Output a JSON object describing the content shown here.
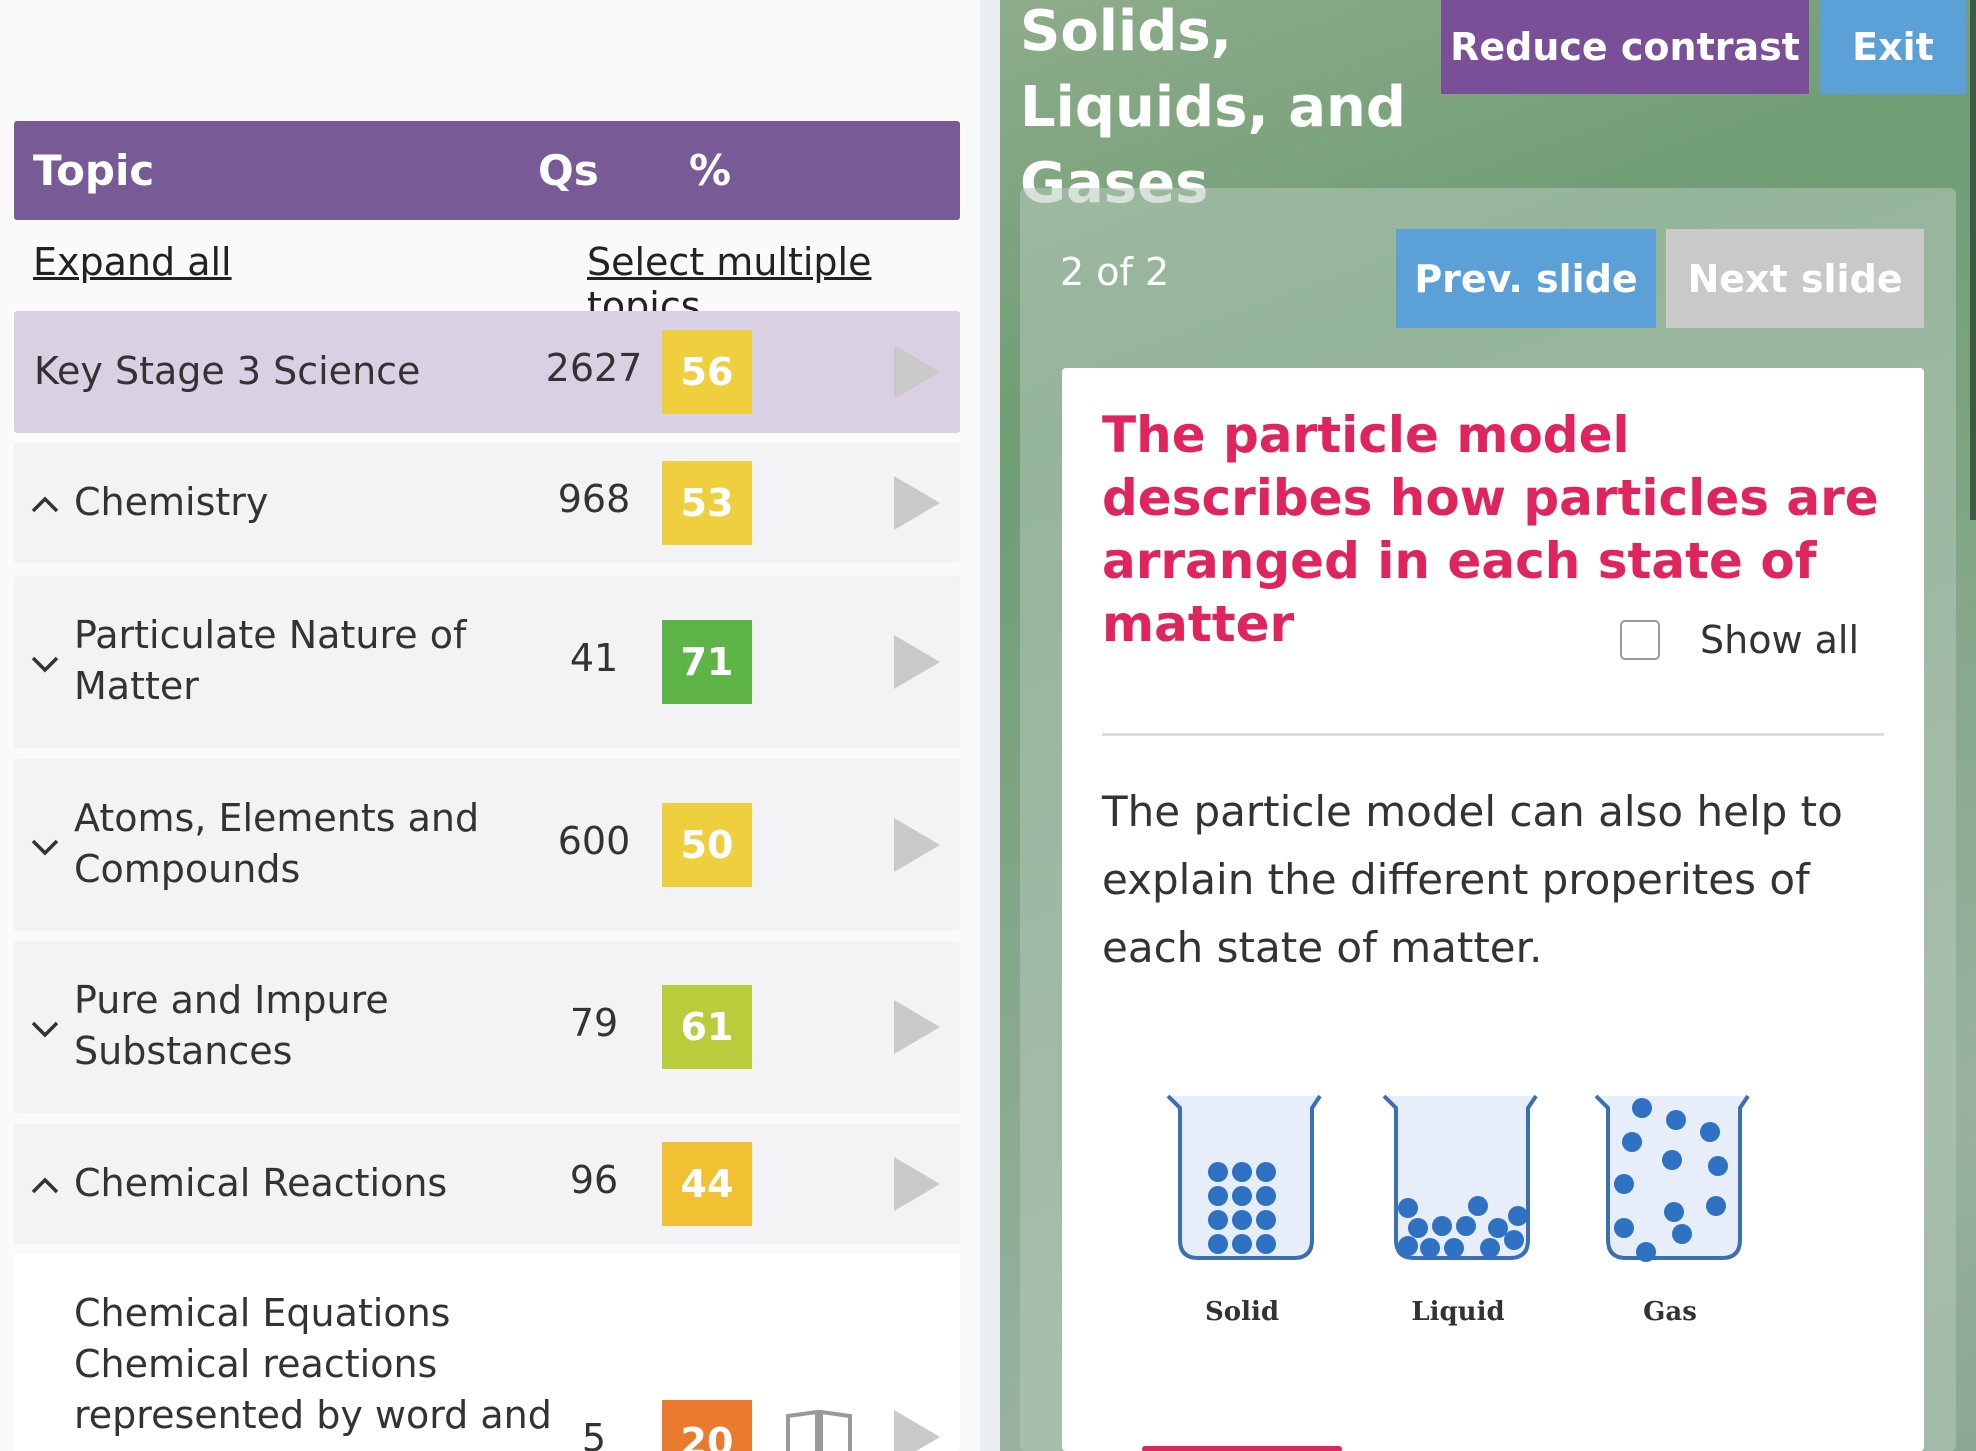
{
  "topic_table": {
    "header": {
      "topic": "Topic",
      "qs": "Qs",
      "pct": "%"
    },
    "expand_all": "Expand all",
    "select_multiple": "Select multiple topics",
    "rows": [
      {
        "name": "Key Stage 3 Science",
        "qs": "2627",
        "pct": "56",
        "pct_color": "#f0cf3e",
        "chevron": "none"
      },
      {
        "name": "Chemistry",
        "qs": "968",
        "pct": "53",
        "pct_color": "#f0cf3e",
        "chevron": "up"
      },
      {
        "name_line1": "Particulate Nature of",
        "name_line2": "Matter",
        "qs": "41",
        "pct": "71",
        "pct_color": "#5fb447",
        "chevron": "down"
      },
      {
        "name_line1": "Atoms, Elements and",
        "name_line2": "Compounds",
        "qs": "600",
        "pct": "50",
        "pct_color": "#f0cf3e",
        "chevron": "down"
      },
      {
        "name_line1": "Pure and Impure",
        "name_line2": "Substances",
        "qs": "79",
        "pct": "61",
        "pct_color": "#b8cc3c",
        "chevron": "down"
      },
      {
        "name": "Chemical Reactions",
        "qs": "96",
        "pct": "44",
        "pct_color": "#f2c033",
        "chevron": "up"
      },
      {
        "name": "Chemical Equations",
        "sub_line1": "Chemical reactions",
        "sub_line2": "represented by word and",
        "qs": "5",
        "pct": "20",
        "pct_color": "#ea7a2e",
        "chevron": "none"
      }
    ]
  },
  "lesson": {
    "title": "Solids, Liquids, and Gases",
    "reduce_contrast": "Reduce contrast",
    "exit": "Exit",
    "slide_counter": "2 of 2",
    "prev_slide": "Prev. slide",
    "next_slide": "Next slide",
    "heading": "The particle model describes how particles are arranged in each state of matter",
    "show_all": "Show all",
    "body": "The particle model can also help to explain the different properites of each state of matter.",
    "diagram_labels": {
      "solid": "Solid",
      "liquid": "Liquid",
      "gas": "Gas"
    }
  },
  "colors": {
    "header_purple": "#775a96",
    "button_purple": "#7b4f97",
    "button_blue": "#5ba1d8",
    "button_disabled": "#c9c9c9",
    "heading_pink": "#e0245e",
    "particle_blue": "#2f72c4"
  },
  "icons": [
    "chevron-up-icon",
    "chevron-down-icon",
    "play-icon",
    "book-icon",
    "checkbox-icon"
  ]
}
